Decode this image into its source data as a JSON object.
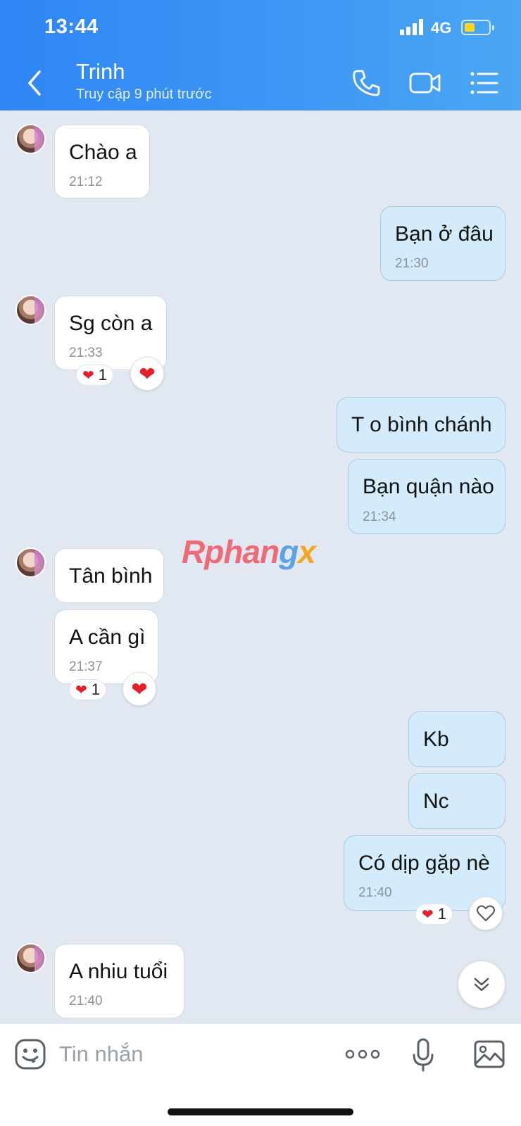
{
  "status_bar": {
    "time": "13:44",
    "network": "4G",
    "battery_color": "#ffd51c"
  },
  "header": {
    "name": "Trinh",
    "last_seen": "Truy cập 9 phút trước"
  },
  "messages": [
    {
      "text": "Chào a",
      "time": "21:12"
    },
    {
      "text": "Bạn ở đâu",
      "time": "21:30"
    },
    {
      "text": "Sg còn a",
      "time": "21:33",
      "reaction_count": "1"
    },
    {
      "text": "T o bình chánh"
    },
    {
      "text": "Bạn quận nào",
      "time": "21:34"
    },
    {
      "text": "Tân bình"
    },
    {
      "text": "A cần gì",
      "time": "21:37",
      "reaction_count": "1"
    },
    {
      "text": "Kb"
    },
    {
      "text": "Nc"
    },
    {
      "text": "Có dịp gặp nè",
      "time": "21:40",
      "reaction_count": "1"
    },
    {
      "text": "A nhiu tuổi",
      "time": "21:40"
    }
  ],
  "watermark": {
    "part1": "Rphan",
    "part2": "g",
    "part3": "x"
  },
  "composer": {
    "placeholder": "Tin nhắn",
    "value": ""
  },
  "colors": {
    "header_start": "#2f86f5",
    "header_end": "#4aa7f3",
    "outgoing_bubble": "#d4ebfb",
    "incoming_bubble": "#ffffff",
    "heart": "#e3202b",
    "background": "#e2e8f1"
  },
  "icons": [
    "back-icon",
    "phone-icon",
    "video-call-icon",
    "menu-list-icon",
    "heart-icon",
    "chevron-double-down-icon",
    "emoji-icon",
    "more-dots-icon",
    "microphone-icon",
    "image-icon"
  ]
}
